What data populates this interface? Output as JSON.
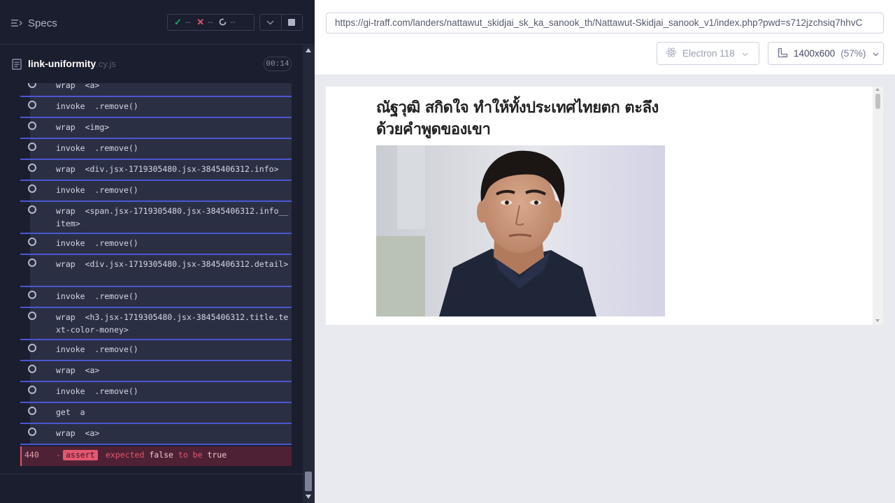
{
  "reporter": {
    "specs_label": "Specs",
    "stats": {
      "passed": "--",
      "failed": "--",
      "pending": "--"
    },
    "spec": {
      "name": "link-uniformity",
      "ext": ".cy.js",
      "timer": "00:14"
    }
  },
  "commands": [
    {
      "name": "wrap",
      "message": "<a>"
    },
    {
      "name": "invoke",
      "message": ".remove()"
    },
    {
      "name": "wrap",
      "message": "<img>"
    },
    {
      "name": "invoke",
      "message": ".remove()"
    },
    {
      "name": "wrap",
      "message": "<div.jsx-1719305480.jsx-3845406312.info>"
    },
    {
      "name": "invoke",
      "message": ".remove()"
    },
    {
      "name": "wrap",
      "message": "<span.jsx-1719305480.jsx-3845406312.info__item>"
    },
    {
      "name": "invoke",
      "message": ".remove()"
    },
    {
      "name": "wrap",
      "message": "<div.jsx-1719305480.jsx-3845406312.detail>"
    },
    {
      "name": "invoke",
      "message": ".remove()"
    },
    {
      "name": "wrap",
      "message": "<h3.jsx-1719305480.jsx-3845406312.title.text-color-money>"
    },
    {
      "name": "invoke",
      "message": ".remove()"
    },
    {
      "name": "wrap",
      "message": "<a>"
    },
    {
      "name": "invoke",
      "message": ".remove()"
    },
    {
      "name": "get",
      "message": "a"
    },
    {
      "name": "wrap",
      "message": "<a>"
    }
  ],
  "failed_assert": {
    "number": "440",
    "dash": "-",
    "tag": "assert",
    "msg_pre": "expected",
    "msg_val1": "false",
    "msg_mid": "to be",
    "msg_val2": "true"
  },
  "runner": {
    "url": "https://gi-traff.com/landers/nattawut_skidjai_sk_ka_sanook_th/Nattawut-Skidjai_sanook_v1/index.php?pwd=s712jzchsiq7hhvC",
    "browser": "Electron 118",
    "viewport": "1400x600",
    "scale": "(57%)"
  },
  "aut": {
    "headline": "ณัฐวุฒิ สกิดใจ ทำให้ทั้งประเทศไทยตก ตะลึงด้วยคำพูดของเขา"
  },
  "colors": {
    "reporter_bg": "#1b1e2e",
    "command_bg": "#2b2f43",
    "command_border": "#4a57d1",
    "fail_red": "#e45770",
    "pass_green": "#1fa971"
  }
}
